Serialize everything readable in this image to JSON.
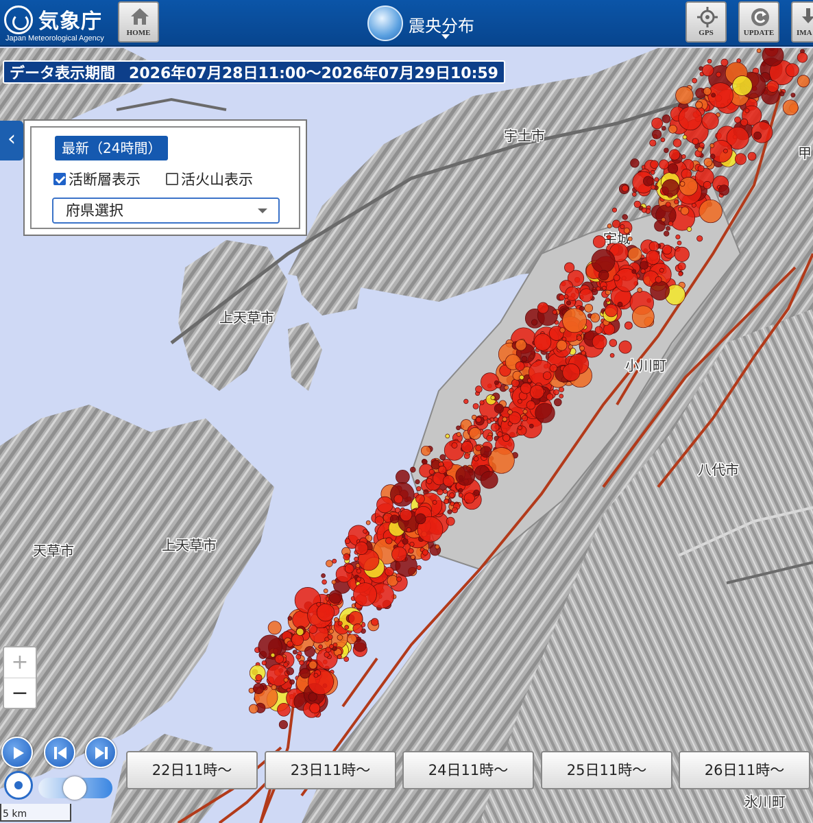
{
  "header": {
    "agency_name": "気象庁",
    "agency_name_en": "Japan Meteorological Agency",
    "home_label": "HOME",
    "nav_title": "震央分布",
    "gps_label": "GPS",
    "update_label": "UPDATE",
    "image_label": "IMA"
  },
  "period": {
    "label": "データ表示期間",
    "value": "2026年07月28日11:00～2026年07月29日10:59"
  },
  "panel": {
    "latest_label": "最新（24時間）",
    "active_fault_label": "活断層表示",
    "active_fault_checked": true,
    "active_volcano_label": "活火山表示",
    "active_volcano_checked": false,
    "prefecture_select": "府県選択"
  },
  "map": {
    "place_labels": [
      "宇土市",
      "宇城",
      "上天草市",
      "小川町",
      "八代市",
      "天草市",
      "上天草市",
      "甲",
      "氷川町"
    ],
    "colors": {
      "sea": "#cfd9f5",
      "land": "#b4b4b4",
      "plain": "#c9c9c9",
      "fault": "#b23a1a",
      "quake_red": "#e82010",
      "quake_dark": "#8a0c0c",
      "quake_orange": "#f06a20",
      "quake_yellow": "#f3e629"
    }
  },
  "zoom": {
    "in_label": "+",
    "out_label": "−"
  },
  "days": [
    {
      "label": "22日11時～"
    },
    {
      "label": "23日11時～"
    },
    {
      "label": "24日11時～"
    },
    {
      "label": "25日11時～"
    },
    {
      "label": "26日11時～"
    }
  ],
  "scale_label": "5 km"
}
